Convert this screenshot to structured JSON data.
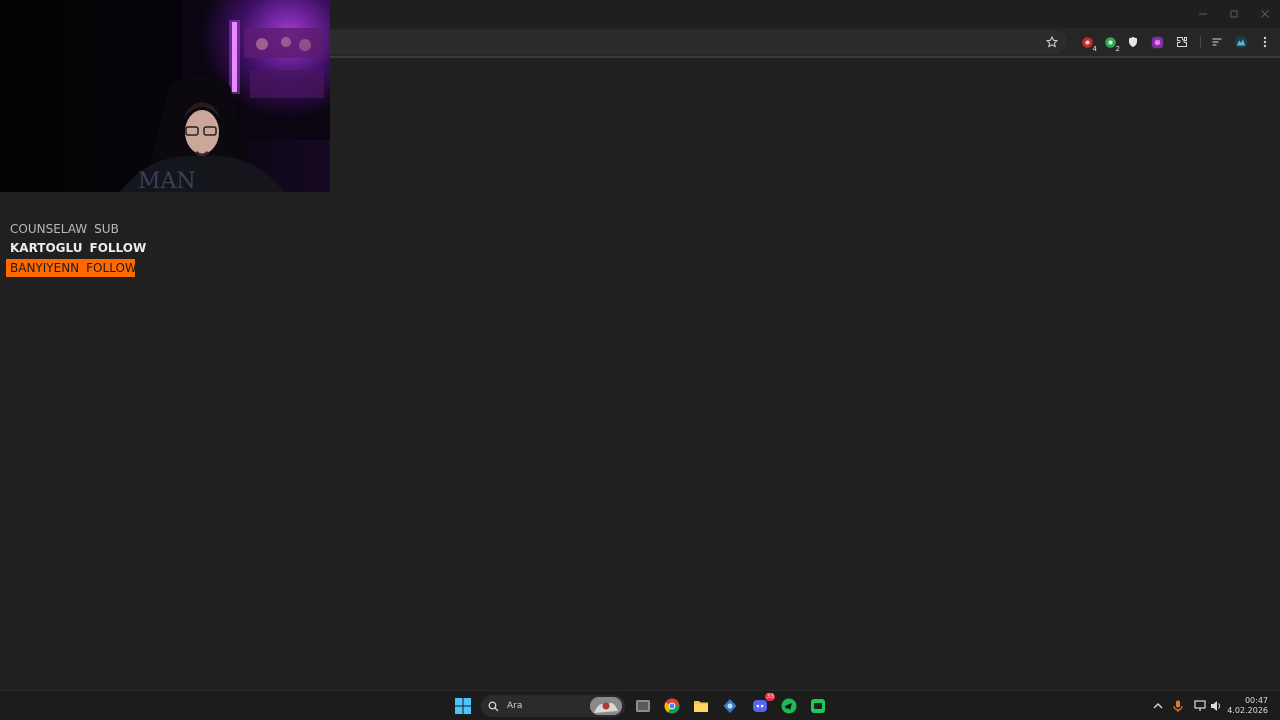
{
  "browser": {
    "window_controls": {
      "minimize": "minimize",
      "maximize": "maximize",
      "close": "close"
    },
    "toolbar_icons": [
      "bookmark-star-icon",
      "extension-red-icon",
      "extension-green-icon",
      "extension-shield-icon",
      "extension-pink-icon",
      "extensions-puzzle-icon",
      "reading-list-icon",
      "profile-avatar-icon",
      "menu-kebab-icon"
    ],
    "extension_badges": {
      "red": "4",
      "green": "2"
    }
  },
  "stream_overlay": {
    "webcam": "webcam-feed",
    "alerts": [
      {
        "name": "COUNSELAW",
        "action": "SUB"
      },
      {
        "name": "KARTOGLU",
        "action": "FOLLOW"
      },
      {
        "name": "BANYIYENN",
        "action": "FOLLOW"
      }
    ],
    "colors": {
      "highlight": "#ff6a00",
      "background": "#202020"
    }
  },
  "taskbar": {
    "search_placeholder": "Ara",
    "discord_badge": "33",
    "time": "00:47",
    "date": "4.02.2026"
  }
}
